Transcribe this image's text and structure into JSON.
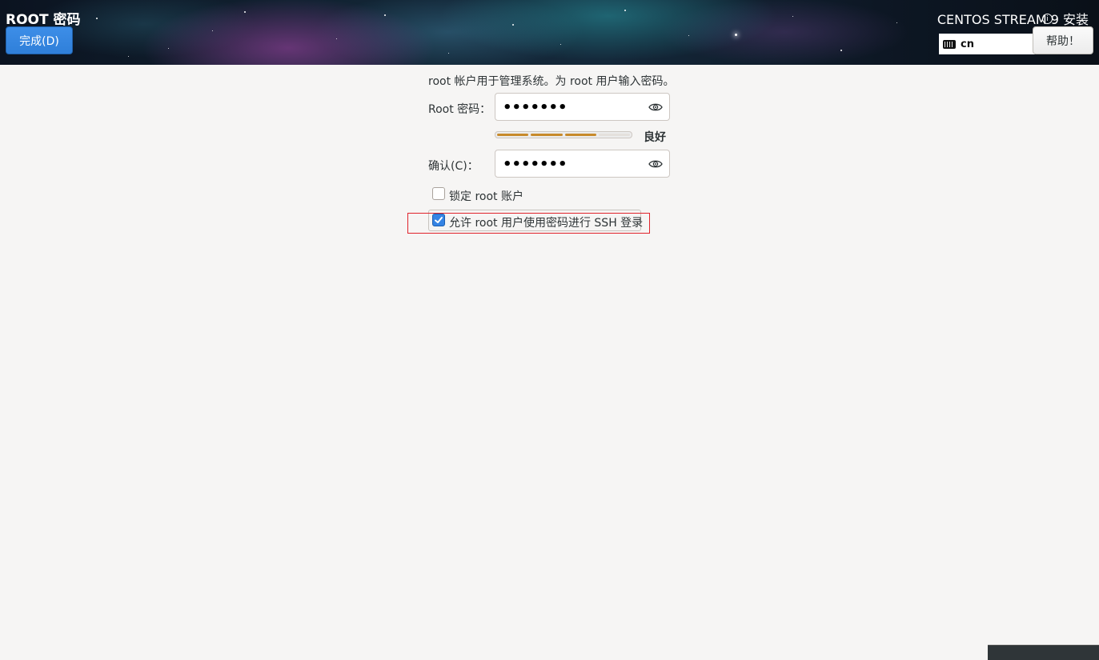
{
  "header": {
    "page_title": "ROOT 密码",
    "done_button_label": "完成(D)",
    "install_title": "CENTOS STREAM 9 安装",
    "keyboard_layout": "cn",
    "help_button_label": "帮助！"
  },
  "form": {
    "description": "root 帐户用于管理系统。为 root 用户输入密码。",
    "root_password_label": "Root 密码：",
    "root_password_value": "•••••••",
    "confirm_label": "确认(C)：",
    "confirm_value": "•••••••",
    "strength": {
      "label": "良好",
      "filled_segments": 3,
      "total_segments": 4,
      "fill_color": "#c78a2b",
      "empty_color": "#e4e1dd"
    },
    "lock_root_checkbox": {
      "label": "锁定 root 账户",
      "checked": false
    },
    "allow_ssh_checkbox": {
      "label": "允许 root 用户使用密码进行 SSH 登录",
      "checked": true
    }
  },
  "colors": {
    "accent": "#3584e4",
    "highlight_box": "#e0232b",
    "background": "#f6f5f4"
  }
}
